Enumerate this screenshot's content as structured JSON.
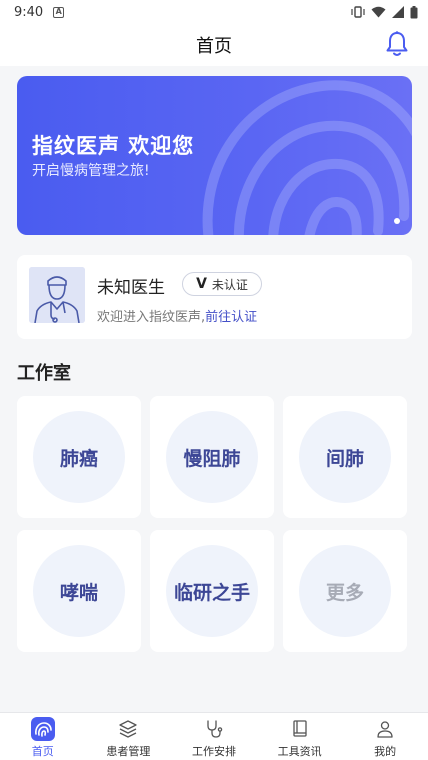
{
  "status_bar": {
    "time": "9:40"
  },
  "header": {
    "title": "首页"
  },
  "banner": {
    "title": "指纹医声 欢迎您",
    "subtitle": "开启慢病管理之旅!"
  },
  "doctor": {
    "name": "未知医生",
    "badge_letter": "V",
    "badge_text": "未认证",
    "welcome_text": "欢迎进入指纹医声,",
    "verify_link": "前往认证"
  },
  "studio": {
    "title": "工作室",
    "tiles": [
      {
        "label": "肺癌"
      },
      {
        "label": "慢阻肺"
      },
      {
        "label": "间肺"
      },
      {
        "label": "哮喘"
      },
      {
        "label": "临研之手"
      },
      {
        "label": "更多"
      }
    ]
  },
  "tabbar": {
    "items": [
      {
        "label": "首页"
      },
      {
        "label": "患者管理"
      },
      {
        "label": "工作安排"
      },
      {
        "label": "工具资讯"
      },
      {
        "label": "我的"
      }
    ]
  },
  "colors": {
    "accent": "#4a5cf0",
    "tile_text": "#3d4796",
    "link": "#4450c8"
  }
}
